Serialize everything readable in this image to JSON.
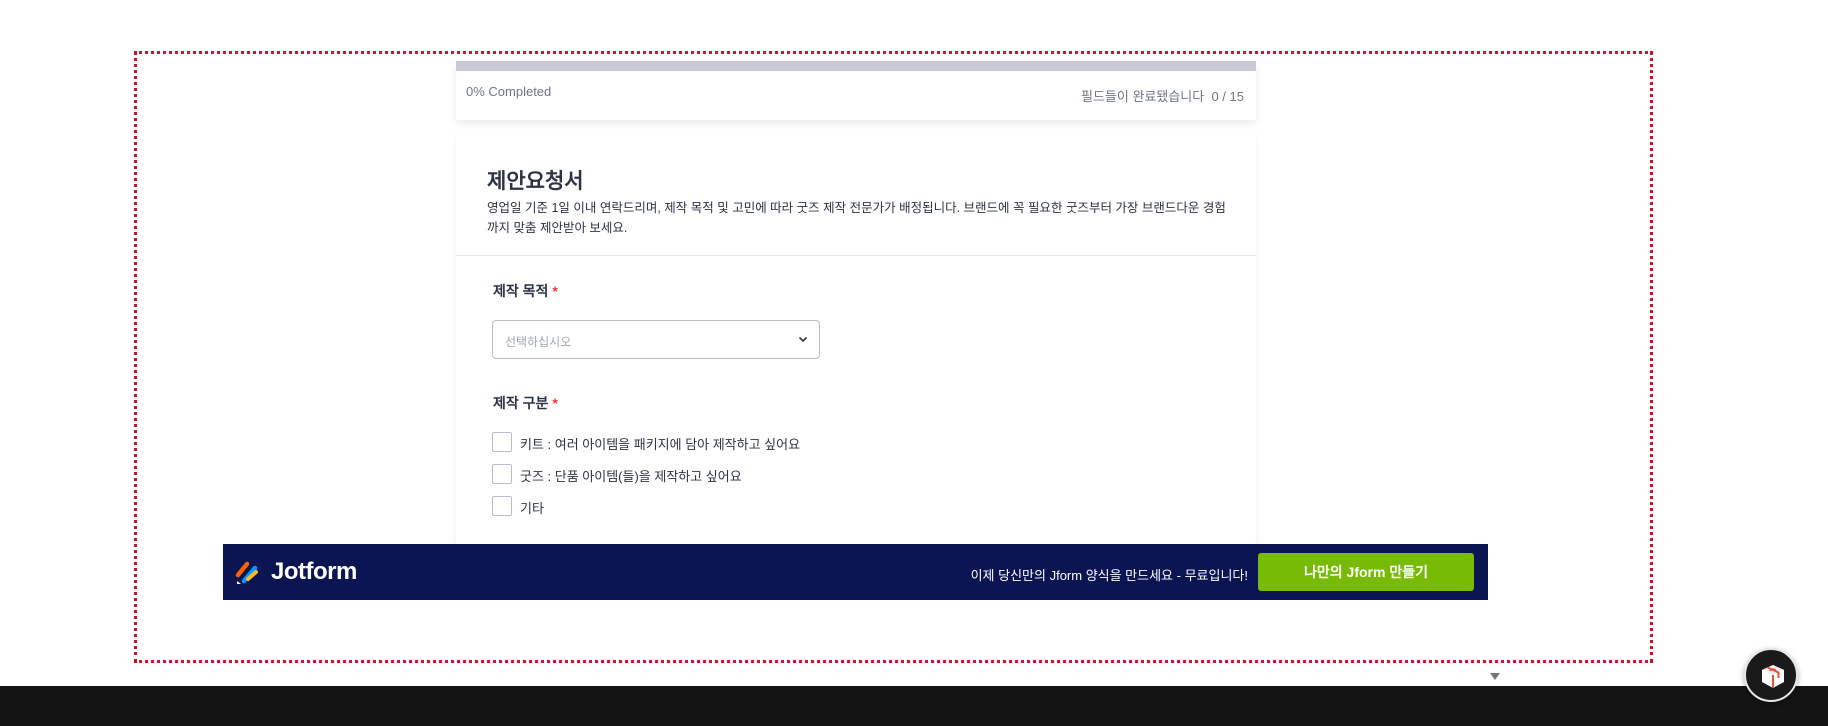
{
  "progress": {
    "fraction": 0.0,
    "percent_text": "0% Completed",
    "fields_text": "필드들이 완료됐습니다",
    "fields_count": "0 / 15",
    "colors": {
      "track": "#c8cbd7",
      "fill": "#0f8cf2"
    }
  },
  "form": {
    "title": "제안요청서",
    "description": "영업일 기준 1일 이내 연락드리며, 제작 목적 및 고민에 따라 굿즈 제작 전문가가 배정됩니다. 브랜드에 꼭 필요한 굿즈부터 가장 브랜드다운 경험까지 맞춤 제안받아 보세요.",
    "purpose": {
      "label": "제작 목적",
      "required_mark": "*",
      "placeholder": "선택하십시오"
    },
    "category": {
      "label": "제작 구분",
      "required_mark": "*",
      "options": [
        {
          "label": "키트 : 여러 아이템을 패키지에 담아 제작하고 싶어요",
          "checked": false
        },
        {
          "label": "굿즈 : 단품 아이템(들)을 제작하고 싶어요",
          "checked": false
        },
        {
          "label": "기타",
          "checked": false
        }
      ]
    }
  },
  "jotform_banner": {
    "brand": "Jotform",
    "promo": "이제 당신만의 Jform 양식을 만드세요 - 무료입니다!",
    "cta": "나만의 Jform 만들기",
    "colors": {
      "background": "#0a1551",
      "cta": "#78bb07"
    }
  },
  "icons": {
    "select_chevron": "chevron-down-icon",
    "logo": "jotform-logo-icon",
    "fab": "gift-box-icon"
  }
}
